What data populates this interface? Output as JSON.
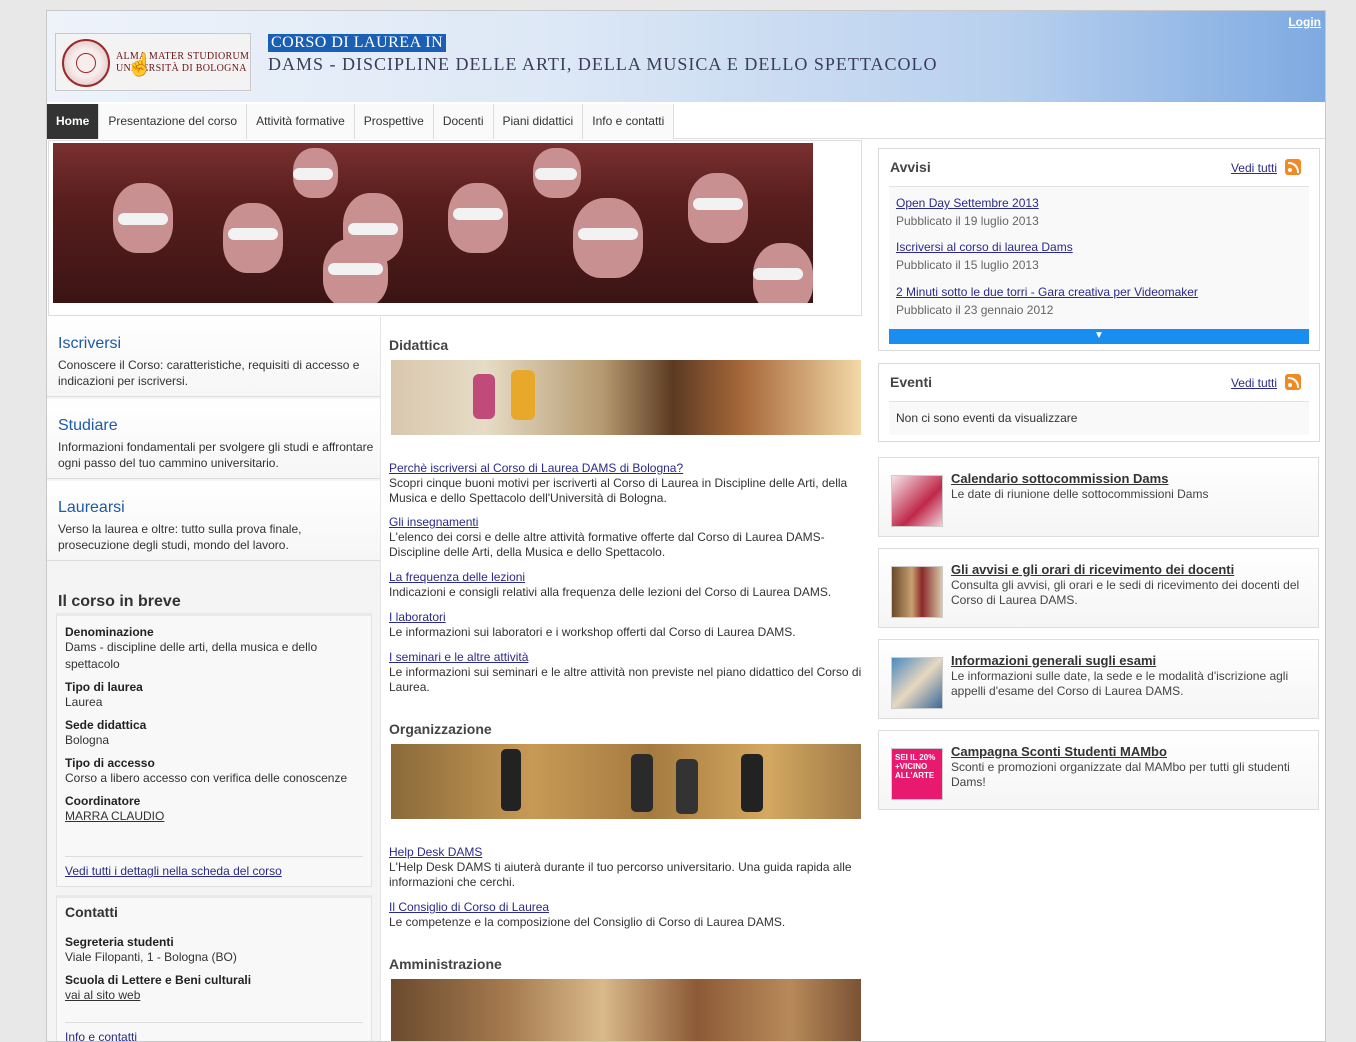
{
  "header": {
    "logo_text": "ALMA MATER STUDIORUM\nUNIVERSITÀ DI BOLOGNA",
    "badge": "CORSO DI LAUREA IN",
    "title": "DAMS - DISCIPLINE DELLE ARTI, DELLA MUSICA  E DELLO SPETTACOLO",
    "login": "Login"
  },
  "nav": [
    "Home",
    "Presentazione del corso",
    "Attività formative",
    "Prospettive",
    "Docenti",
    "Piani didattici",
    "Info e contatti"
  ],
  "promos": [
    {
      "title": "Iscriversi",
      "text": "Conoscere il Corso: caratteristiche, requisiti di accesso e indicazioni per iscriversi."
    },
    {
      "title": "Studiare",
      "text": "Informazioni fondamentali per svolgere gli studi e affrontare ogni passo del tuo cammino universitario."
    },
    {
      "title": "Laurearsi",
      "text": "Verso la laurea e oltre: tutto sulla prova finale, prosecuzione degli studi, mondo del lavoro."
    }
  ],
  "breve": {
    "title": "Il corso in breve",
    "fields": [
      {
        "label": "Denominazione",
        "value": "Dams - discipline delle arti, della musica e dello spettacolo"
      },
      {
        "label": "Tipo di laurea",
        "value": "Laurea"
      },
      {
        "label": "Sede didattica",
        "value": "Bologna"
      },
      {
        "label": "Tipo di accesso",
        "value": "Corso a libero accesso con verifica delle conoscenze"
      },
      {
        "label": "Coordinatore",
        "value": "MARRA CLAUDIO"
      }
    ],
    "details_link": "Vedi tutti i dettagli nella scheda del corso"
  },
  "contatti": {
    "title": "Contatti",
    "segreteria_label": "Segreteria studenti",
    "segreteria_value": "Viale Filopanti, 1 - Bologna (BO)",
    "scuola_label": "Scuola di Lettere e Beni culturali",
    "scuola_link": "vai al sito web",
    "info_link": "Info e contatti"
  },
  "didattica": {
    "title": "Didattica",
    "entries": [
      {
        "link": "Perchè iscriversi al Corso di Laurea DAMS di Bologna?",
        "desc": "Scopri cinque buoni motivi per iscriverti al Corso di Laurea in Discipline delle Arti, della Musica e dello Spettacolo dell'Università di Bologna."
      },
      {
        "link": "Gli insegnamenti",
        "desc": "L'elenco dei corsi e delle altre attività formative offerte dal Corso di Laurea DAMS-Discipline delle Arti, della Musica e dello Spettacolo."
      },
      {
        "link": "La frequenza delle lezioni",
        "desc": "Indicazioni e consigli relativi alla frequenza delle lezioni del Corso di Laurea DAMS."
      },
      {
        "link": "I laboratori",
        "desc": "Le informazioni sui laboratori e i workshop offerti dal Corso di Laurea DAMS."
      },
      {
        "link": "I seminari e le altre attività",
        "desc": "Le informazioni sui seminari e le altre attività non previste nel piano didattico del Corso di Laurea."
      }
    ]
  },
  "organizzazione": {
    "title": "Organizzazione",
    "entries": [
      {
        "link": "Help Desk DAMS",
        "desc": "L'Help Desk DAMS ti aiuterà durante il tuo percorso universitario. Una guida rapida alle informazioni che cerchi."
      },
      {
        "link": "Il Consiglio di Corso di Laurea",
        "desc": "Le competenze e la composizione del Consiglio di Corso di Laurea DAMS."
      }
    ]
  },
  "amministrazione": {
    "title": "Amministrazione"
  },
  "avvisi": {
    "title": "Avvisi",
    "more": "Vedi tutti",
    "items": [
      {
        "title": "Open Day Settembre 2013",
        "date": "Pubblicato il 19 luglio 2013"
      },
      {
        "title": "Iscriversi al corso di laurea Dams",
        "date": "Pubblicato il 15 luglio 2013"
      },
      {
        "title": "2 Minuti sotto le due torri - Gara creativa per Videomaker",
        "date": "Pubblicato il 23 gennaio 2012"
      }
    ],
    "arrow": "▼"
  },
  "eventi": {
    "title": "Eventi",
    "more": "Vedi tutti",
    "empty": "Non ci sono eventi da visualizzare"
  },
  "cards": [
    {
      "title": "Calendario sottocommission Dams",
      "text": "Le date di riunione delle sottocommissioni Dams"
    },
    {
      "title": "Gli avvisi e gli orari di ricevimento dei docenti",
      "text": "Consulta gli avvisi, gli orari e le sedi di ricevimento dei docenti del Corso di Laurea DAMS."
    },
    {
      "title": "Informazioni generali sugli esami",
      "text": "Le informazioni sulle date, la sede e le modalità d'iscrizione agli appelli d'esame del Corso di Laurea DAMS."
    },
    {
      "title": "Campagna Sconti Studenti MAMbo",
      "text": "Sconti e promozioni organizzate dal MAMbo per tutti gli studenti Dams!"
    }
  ],
  "mambo_thumb_text": "SEI IL 20% +VICINO ALL'ARTE",
  "colors": {
    "accent_blue": "#1a5fb4",
    "link": "#2a2a8c",
    "promo_title": "#1e5aa8",
    "rss": "#f08a24",
    "nav_active": "#333333"
  }
}
